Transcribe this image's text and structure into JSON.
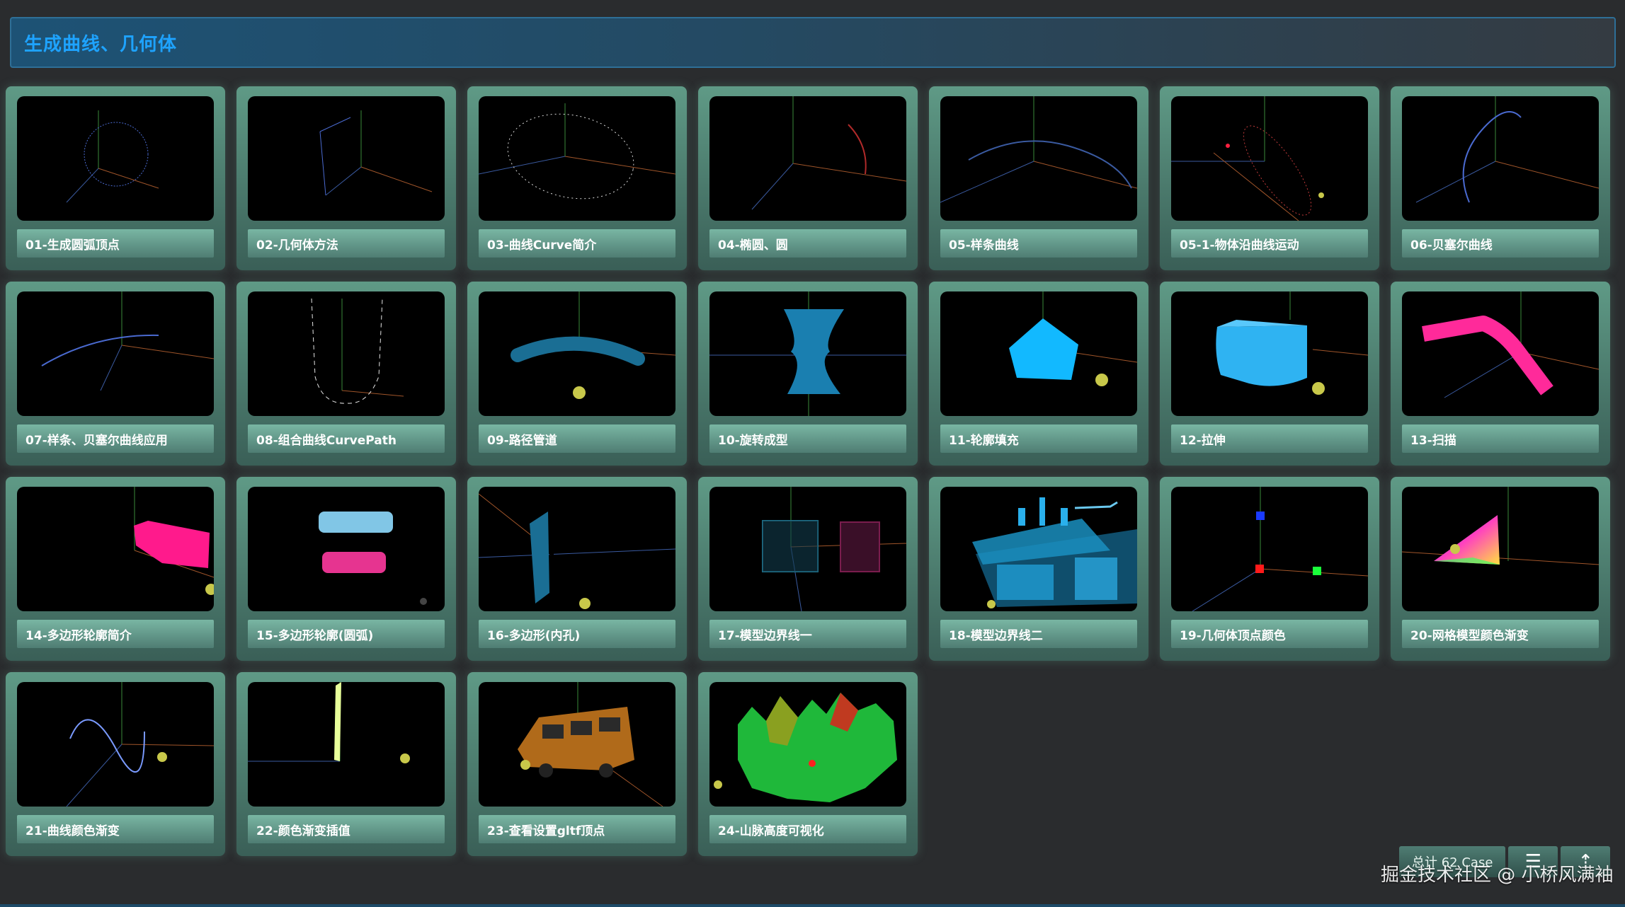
{
  "header": {
    "title": "生成曲线、几何体"
  },
  "cards": [
    {
      "label": "01-生成圆弧顶点",
      "icon": "circle-arc"
    },
    {
      "label": "02-几何体方法",
      "icon": "geometry-method"
    },
    {
      "label": "03-曲线Curve简介",
      "icon": "ellipse-dots"
    },
    {
      "label": "04-椭圆、圆",
      "icon": "ellipse-arc"
    },
    {
      "label": "05-样条曲线",
      "icon": "spline"
    },
    {
      "label": "05-1-物体沿曲线运动",
      "icon": "object-on-curve"
    },
    {
      "label": "06-贝塞尔曲线",
      "icon": "bezier"
    },
    {
      "label": "07-样条、贝塞尔曲线应用",
      "icon": "spline-bezier-app"
    },
    {
      "label": "08-组合曲线CurvePath",
      "icon": "curve-path"
    },
    {
      "label": "09-路径管道",
      "icon": "tube"
    },
    {
      "label": "10-旋转成型",
      "icon": "lathe"
    },
    {
      "label": "11-轮廓填充",
      "icon": "pentagon"
    },
    {
      "label": "12-拉伸",
      "icon": "extrude"
    },
    {
      "label": "13-扫描",
      "icon": "sweep"
    },
    {
      "label": "14-多边形轮廓简介",
      "icon": "polygon-shape"
    },
    {
      "label": "15-多边形轮廓(圆弧)",
      "icon": "polygon-arc"
    },
    {
      "label": "16-多边形(内孔)",
      "icon": "polygon-hole"
    },
    {
      "label": "17-模型边界线一",
      "icon": "edges-one"
    },
    {
      "label": "18-模型边界线二",
      "icon": "city-edges"
    },
    {
      "label": "19-几何体顶点颜色",
      "icon": "vertex-colors"
    },
    {
      "label": "20-网格模型颜色渐变",
      "icon": "color-gradient-mesh"
    },
    {
      "label": "21-曲线颜色渐变",
      "icon": "curve-gradient"
    },
    {
      "label": "22-颜色渐变插值",
      "icon": "color-lerp"
    },
    {
      "label": "23-查看设置gltf顶点",
      "icon": "gltf-bus"
    },
    {
      "label": "24-山脉高度可视化",
      "icon": "terrain"
    }
  ],
  "footer": {
    "count": "总计 62 Case",
    "list_icon": "list-icon",
    "top_icon": "top-icon"
  },
  "watermark": "掘金技术社区 @ 小桥风满袖"
}
